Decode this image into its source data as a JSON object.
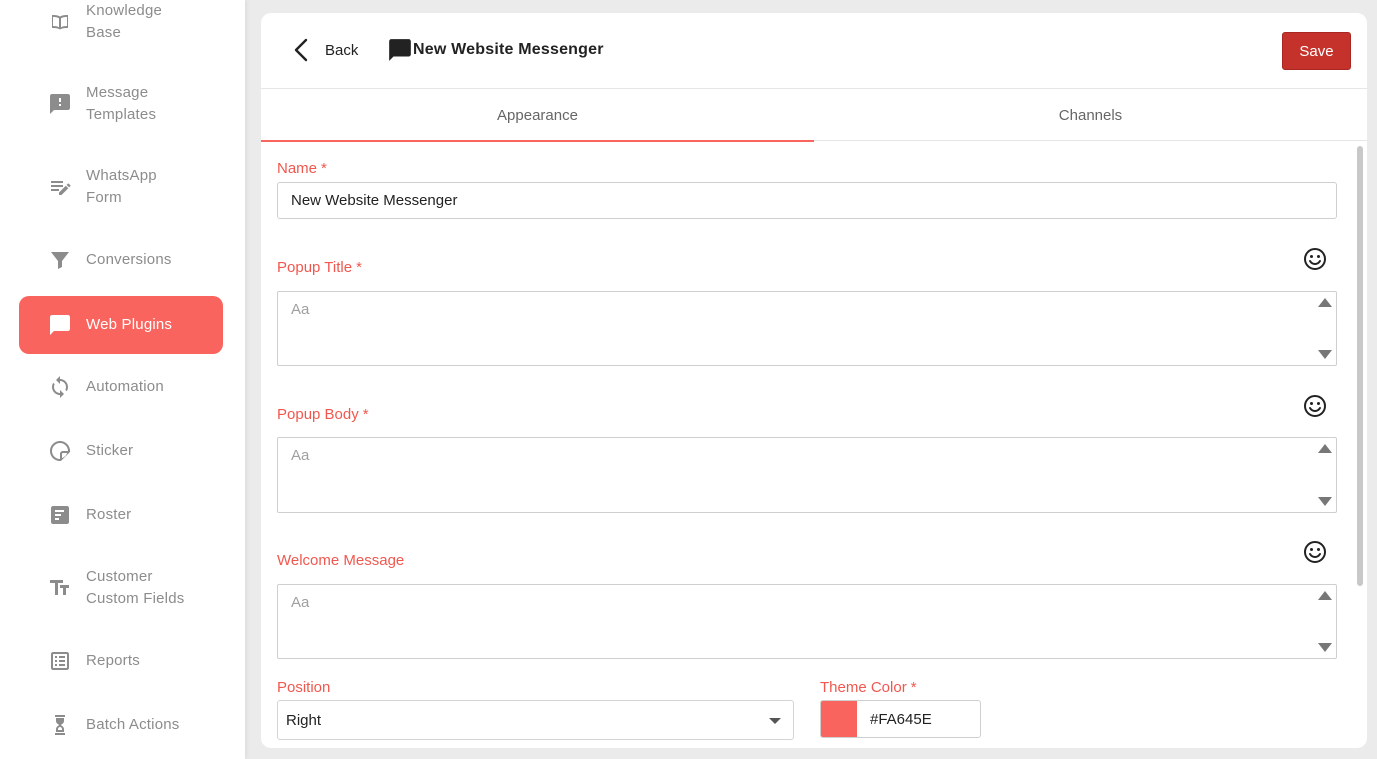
{
  "sidebar": {
    "items": [
      {
        "label_1": "Knowledge",
        "label_2": "Base",
        "icon": "book-icon"
      },
      {
        "label_1": "Message",
        "label_2": "Templates",
        "icon": "message-alert-icon"
      },
      {
        "label_1": "WhatsApp",
        "label_2": "Form",
        "icon": "form-edit-icon"
      },
      {
        "label_1": "Conversions",
        "icon": "filter-icon"
      },
      {
        "label_1": "Web Plugins",
        "icon": "chat-bubble-icon",
        "active": true
      },
      {
        "label_1": "Automation",
        "icon": "sync-icon"
      },
      {
        "label_1": "Sticker",
        "icon": "sticker-icon"
      },
      {
        "label_1": "Roster",
        "icon": "roster-icon"
      },
      {
        "label_1": "Customer",
        "label_2": "Custom Fields",
        "icon": "text-fields-icon"
      },
      {
        "label_1": "Reports",
        "icon": "list-report-icon"
      },
      {
        "label_1": "Batch Actions",
        "icon": "hourglass-icon"
      }
    ]
  },
  "header": {
    "back_label": "Back",
    "title": "New Website Messenger",
    "save_label": "Save"
  },
  "tabs": [
    {
      "label": "Appearance",
      "active": true
    },
    {
      "label": "Channels",
      "active": false
    }
  ],
  "form": {
    "name": {
      "label": "Name",
      "required": "*",
      "value": "New Website Messenger"
    },
    "popup_title": {
      "label": "Popup Title",
      "required": "*",
      "placeholder": "Aa"
    },
    "popup_body": {
      "label": "Popup Body",
      "required": "*",
      "placeholder": "Aa"
    },
    "welcome_message": {
      "label": "Welcome Message",
      "placeholder": "Aa"
    },
    "position": {
      "label": "Position",
      "value": "Right"
    },
    "theme_color": {
      "label": "Theme Color",
      "required": "*",
      "value": "#FA645E"
    }
  },
  "colors": {
    "accent": "#FA645E",
    "save_button": "#C5322B",
    "label": "#F0584F"
  }
}
